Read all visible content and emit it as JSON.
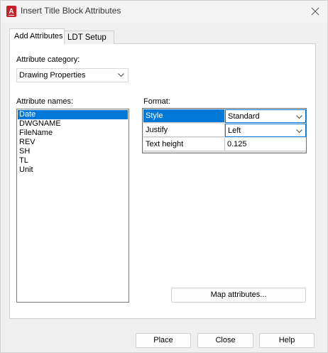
{
  "window": {
    "title": "Insert Title Block Attributes"
  },
  "tabs": [
    {
      "label": "Add Attributes",
      "active": true
    },
    {
      "label": "LDT Setup",
      "active": false
    }
  ],
  "attribute_category": {
    "label": "Attribute category:",
    "selected": "Drawing Properties"
  },
  "attribute_names": {
    "label": "Attribute names:",
    "items": [
      "Date",
      "DWGNAME",
      "FileName",
      "REV",
      "SH",
      "TL",
      "Unit"
    ],
    "selected_index": 0
  },
  "format": {
    "label": "Format:",
    "rows": [
      {
        "name": "Style",
        "value": "Standard"
      },
      {
        "name": "Justify",
        "value": "Left"
      },
      {
        "name": "Text height",
        "value": "0.125"
      }
    ]
  },
  "buttons": {
    "map_attributes": "Map attributes...",
    "place": "Place",
    "close": "Close",
    "help": "Help"
  },
  "colors": {
    "selection": "#0078d7",
    "app_icon": "#c7222a"
  },
  "icons": {
    "app": "autocad-app-icon",
    "close": "close-icon",
    "dropdown": "chevron-down-icon"
  }
}
